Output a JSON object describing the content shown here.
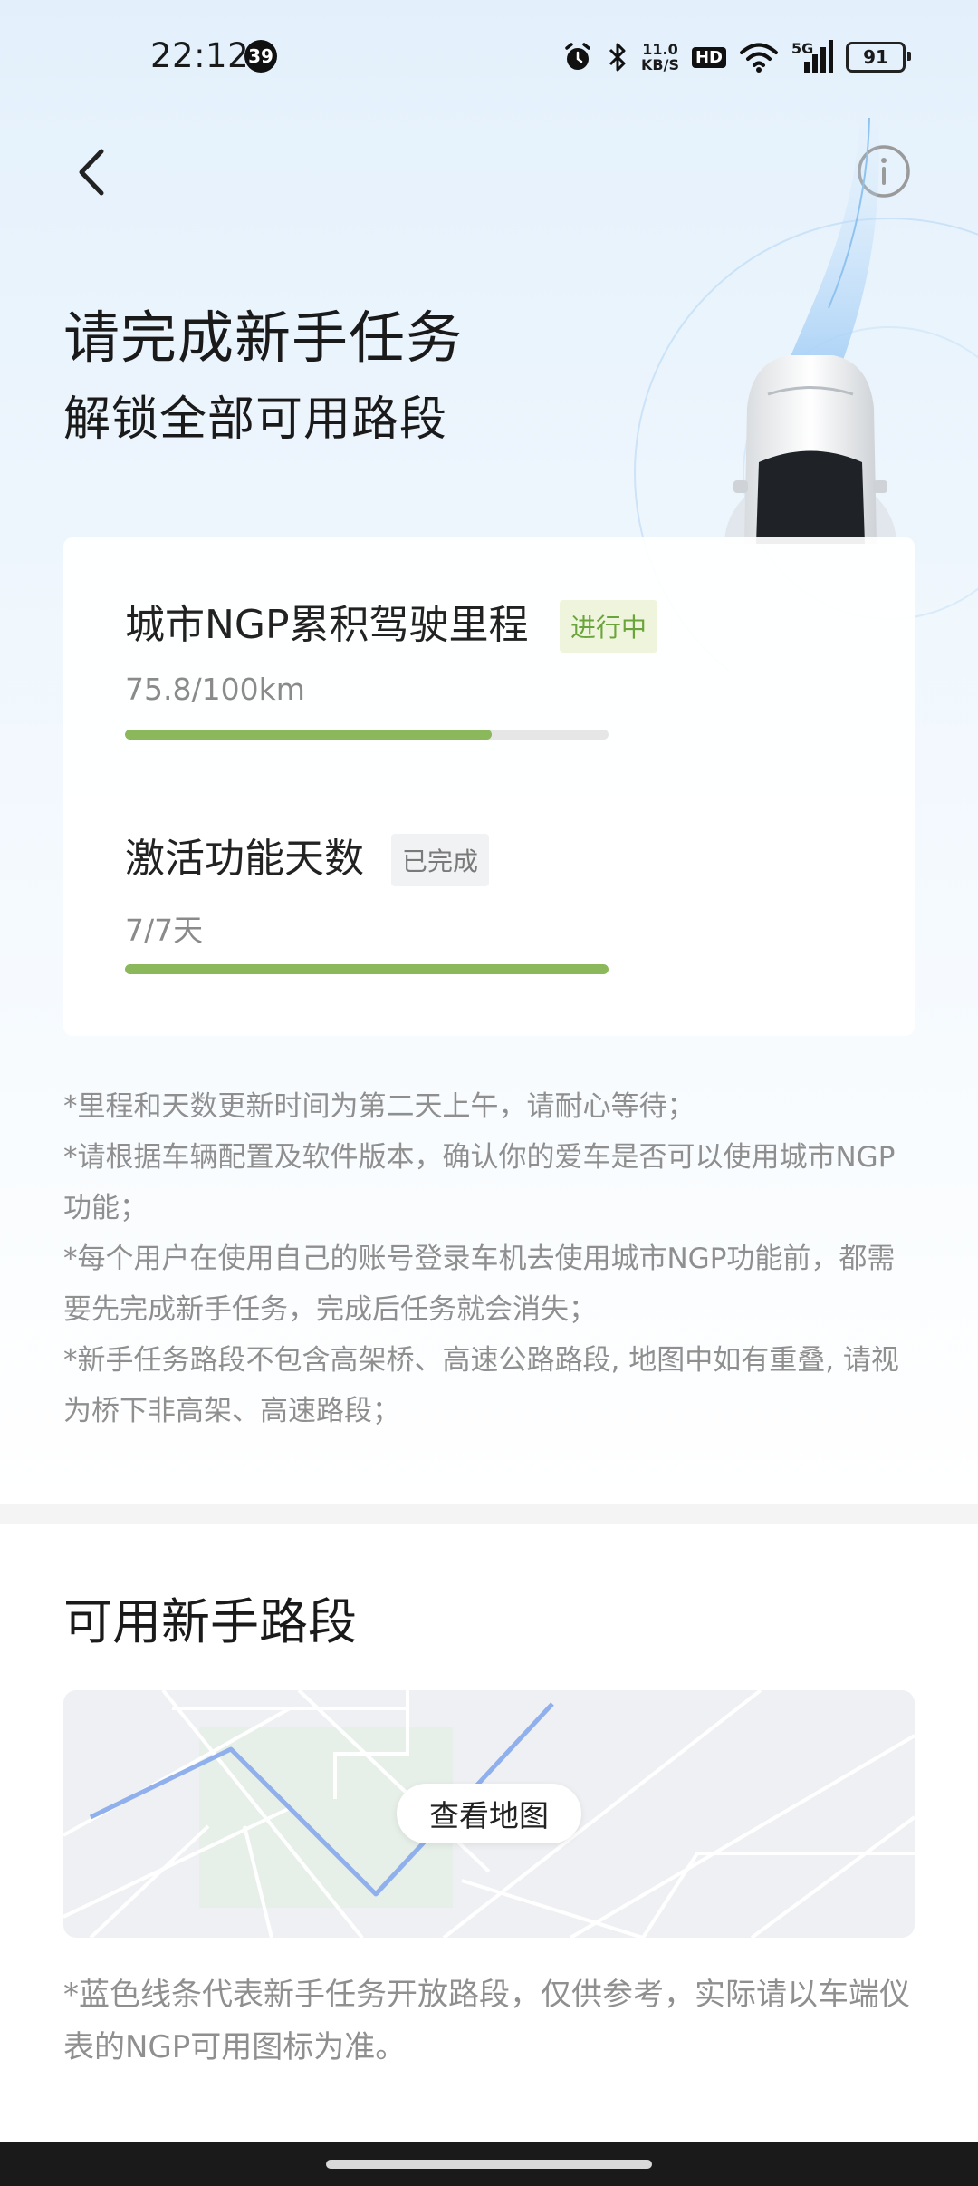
{
  "status_bar": {
    "time": "22:12",
    "notification_count": "39",
    "net_speed_value": "11.0",
    "net_speed_unit": "KB/S",
    "hd_label": "HD",
    "signal_label": "5G",
    "battery": "91"
  },
  "header": {
    "title": "请完成新手任务",
    "subtitle": "解锁全部可用路段"
  },
  "tasks": [
    {
      "name": "城市NGP累积驾驶里程",
      "status": "进行中",
      "value": "75.8/100km",
      "progress": 0.758
    },
    {
      "name": "激活功能天数",
      "status": "已完成",
      "value": "7/7天",
      "progress": 1.0
    }
  ],
  "notes": [
    "*里程和天数更新时间为第二天上午，请耐心等待；",
    "*请根据车辆配置及软件版本，确认你的爱车是否可以使用城市NGP功能；",
    "*每个用户在使用自己的账号登录车机去使用城市NGP功能前，都需要先完成新手任务，完成后任务就会消失；",
    "*新手任务路段不包含高架桥、高速公路路段, 地图中如有重叠, 请视为桥下非高架、高速路段；"
  ],
  "routes": {
    "section_title": "可用新手路段",
    "map_button": "查看地图",
    "note": "*蓝色线条代表新手任务开放路段，仅供参考，实际请以车端仪表的NGP可用图标为准。"
  },
  "colors": {
    "progress_fill": "#8ab85a",
    "progress_track": "#e6e6e6",
    "status_in_progress": "#6aa53b",
    "route_line": "#8fb0ec"
  },
  "icons": {
    "back": "chevron-left-icon",
    "info": "info-circle-icon",
    "alarm": "alarm-icon",
    "bluetooth": "bluetooth-icon",
    "wifi": "wifi-icon",
    "signal": "cell-signal-icon"
  }
}
